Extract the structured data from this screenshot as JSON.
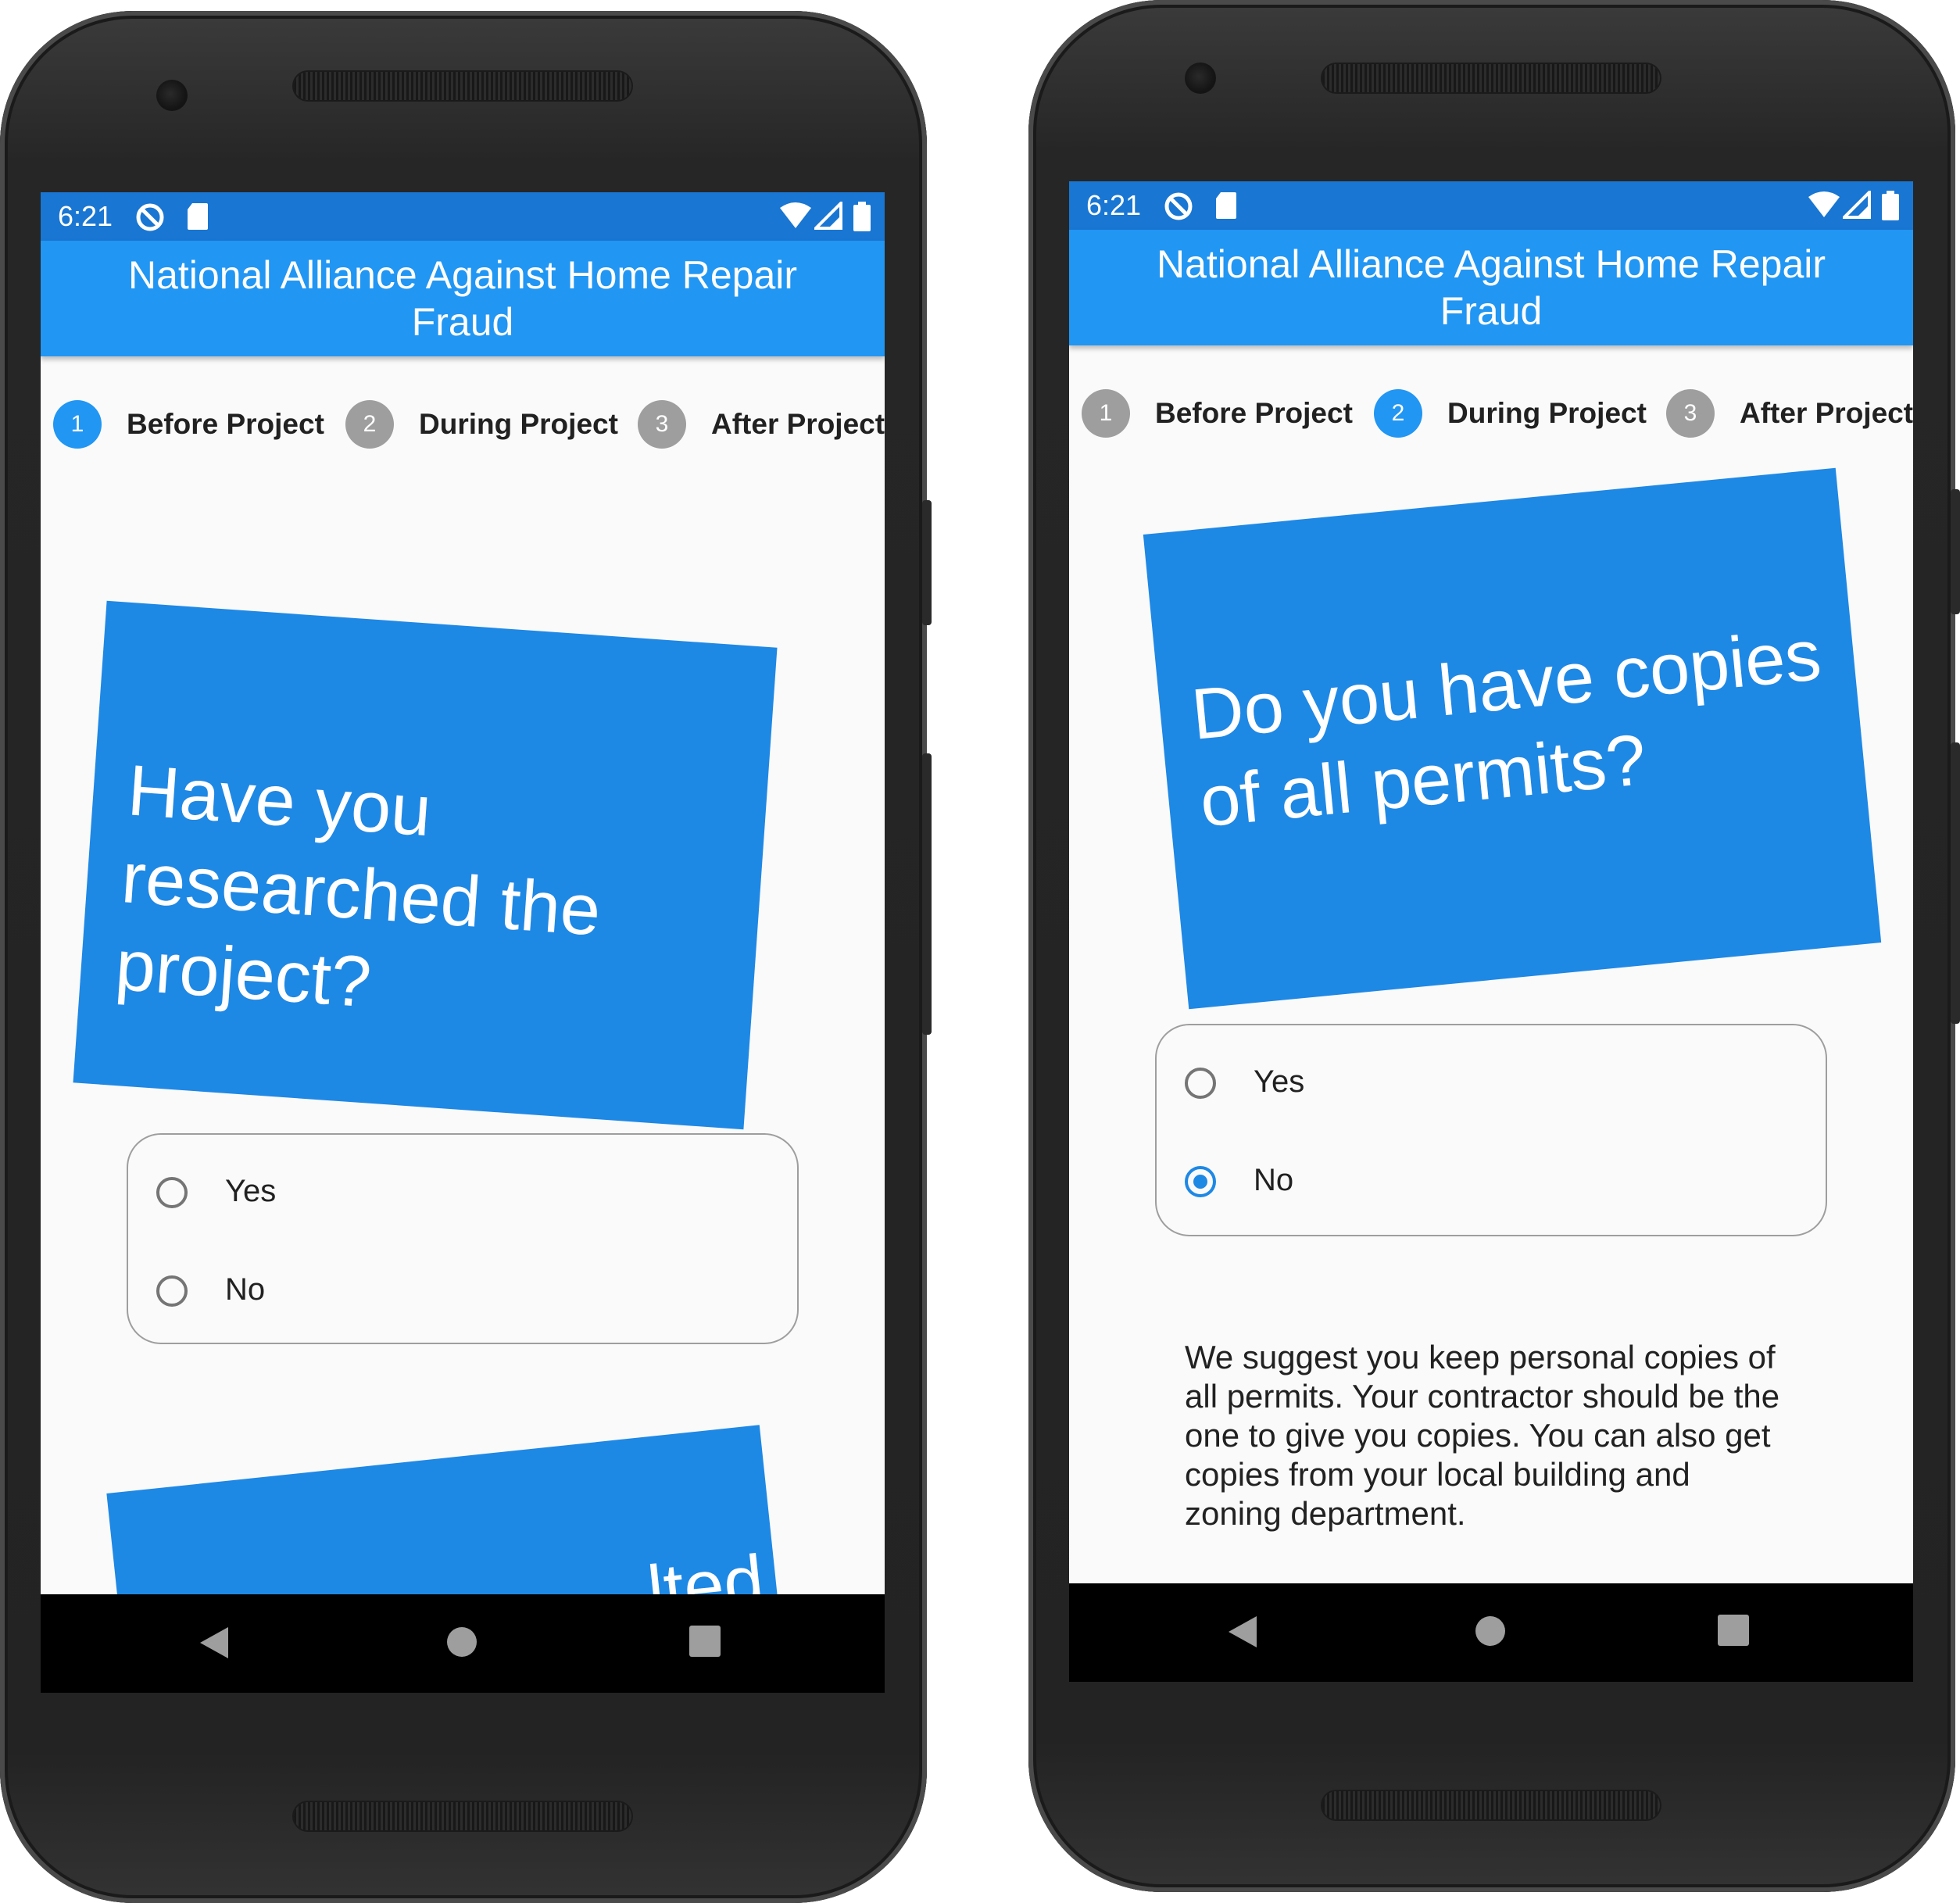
{
  "app": {
    "title": "National Alliance Against Home Repair Fraud",
    "status_time": "6:21",
    "colors": {
      "status_bar": "#1976d2",
      "app_bar": "#2196f3",
      "card": "#1e88e5",
      "step_active": "#2196f3",
      "step_inactive": "#9e9e9e"
    }
  },
  "steps": [
    {
      "number": "1",
      "label": "Before Project"
    },
    {
      "number": "2",
      "label": "During Project"
    },
    {
      "number": "3",
      "label": "After Project"
    }
  ],
  "left": {
    "active_step": 1,
    "question_lines": [
      "Have you",
      "researched the",
      "project?"
    ],
    "next_card_partial_text": "lted",
    "options": [
      {
        "label": "Yes",
        "selected": false
      },
      {
        "label": "No",
        "selected": false
      }
    ]
  },
  "right": {
    "active_step": 2,
    "question_lines": [
      "Do you have copies",
      "of all permits?"
    ],
    "options": [
      {
        "label": "Yes",
        "selected": false
      },
      {
        "label": "No",
        "selected": true
      }
    ],
    "suggestion_lines": [
      "We suggest you keep personal copies of",
      "all permits. Your contractor should be the",
      "one to give you copies. You can also get",
      "copies from your local building and",
      "zoning department."
    ]
  },
  "icons": {
    "status": [
      "data-saver-icon",
      "sd-card-icon",
      "wifi-icon",
      "signal-icon",
      "battery-icon"
    ],
    "nav": [
      "back-icon",
      "home-icon",
      "recents-icon"
    ]
  }
}
